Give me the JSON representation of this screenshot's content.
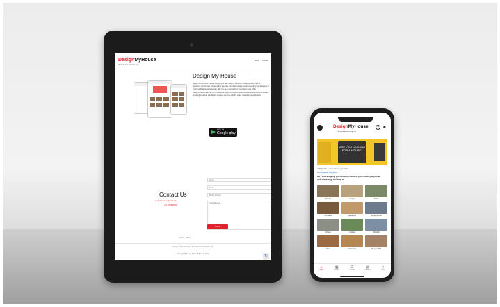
{
  "tablet": {
    "logo_part1": "Design",
    "logo_part2": "MyHouse",
    "tagline": "An Elezi Seven Design Co",
    "nav": [
      "Home",
      "Contact"
    ],
    "heading": "Design My House",
    "description": "Design My House is the planning wing of SRL (Seema Infratech Private Limited). SRL is a registered construction company that provides complete housing solutions starting from Planning to Finishing (Nakshe se Ghar tak). SRL has been reputedly in the market since 1996. Designmyhouse.app has an innovative & expert team of Professional Architects/Engineers who are providing customer satisfaction oriented services with the under mentioned specifications.",
    "gplay_small": "GET IT ON",
    "gplay_large": "Google play",
    "contact_title": "Contact Us",
    "contact_email": "designmyhouse@gmail.com",
    "contact_phone": "+91 9000000000",
    "form": {
      "name": "Name",
      "email": "Email",
      "phone": "Phone Number",
      "message": "Your Message",
      "submit": "Submit"
    },
    "footer_nav": [
      "Home",
      "About"
    ],
    "footer_line1": "Designed And Developed by Grafotel Services Pvt. Ltd.",
    "footer_line2": "©Copyright Seema Infratech Pvt. Ltd 2021"
  },
  "phone": {
    "logo_part1": "Design",
    "logo_part2": "MyHouse",
    "tagline": "An Elezi Seven Design Co",
    "banner_text": "ARE YOU LOOKING FOR A HOUSE?",
    "location_label": "Hi Prakhash ji ! Here Nearer you Select",
    "location_value": "Kumarnagaila, Bengaluru",
    "start_text": "Let's start designing your House by choosing your House type you like",
    "start_text_hindi": "अपनी पसंद का घर चुनें और डिज़ाइन करें",
    "categories": [
      {
        "label": "Simplex",
        "color": "#8b7559"
      },
      {
        "label": "Duplex",
        "color": "#b8a27d"
      },
      {
        "label": "Triplex",
        "color": "#7d8a6a"
      },
      {
        "label": "Bungalow",
        "color": "#7a5a3c"
      },
      {
        "label": "Apartment",
        "color": "#c09a6a"
      },
      {
        "label": "Shopping Mall",
        "color": "#6e7b8c"
      },
      {
        "label": "School",
        "color": "#8c8f85"
      },
      {
        "label": "Cottage",
        "color": "#6b8a5a"
      },
      {
        "label": "Hospital",
        "color": "#7c8fa4"
      },
      {
        "label": "Hotel",
        "color": "#9a6b44"
      },
      {
        "label": "Restaurant",
        "color": "#b58752"
      },
      {
        "label": "Banquet Hall",
        "color": "#a48266"
      }
    ],
    "tabs": [
      {
        "label": "Home",
        "icon": "⌂"
      },
      {
        "label": "Designs",
        "icon": "▦"
      },
      {
        "label": "Account",
        "icon": "☰"
      },
      {
        "label": "Compare",
        "icon": "▤"
      },
      {
        "label": "Share",
        "icon": "<"
      }
    ]
  },
  "colors": {
    "brand_red": "#e0232f"
  }
}
